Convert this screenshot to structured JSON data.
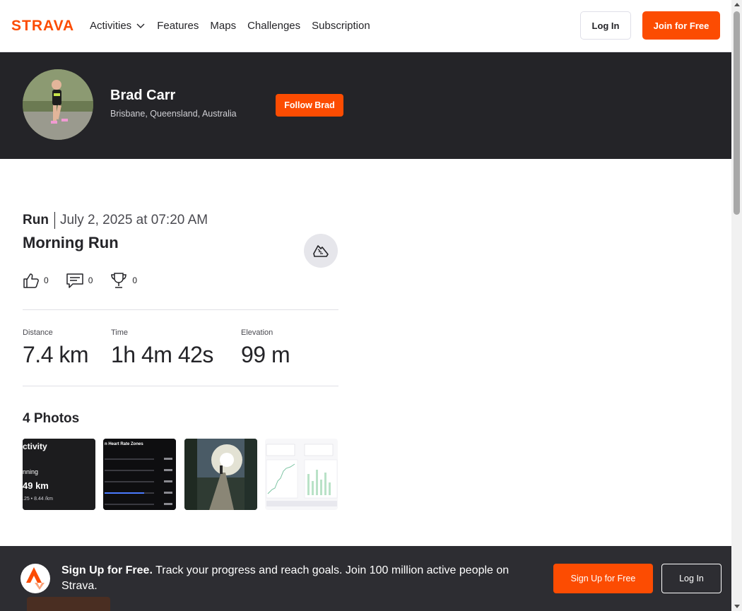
{
  "nav": {
    "brand": "STRAVA",
    "items": [
      {
        "label": "Activities",
        "has_dropdown": true
      },
      {
        "label": "Features"
      },
      {
        "label": "Maps"
      },
      {
        "label": "Challenges"
      },
      {
        "label": "Subscription"
      }
    ],
    "login_label": "Log In",
    "join_label": "Join for Free"
  },
  "athlete": {
    "name": "Brad Carr",
    "location": "Brisbane, Queensland, Australia",
    "follow_label": "Follow Brad"
  },
  "activity": {
    "type": "Run",
    "date": "July 2, 2025 at 07:20 AM",
    "title": "Morning Run",
    "kudos_count": "0",
    "comments_count": "0",
    "achievements_count": "0",
    "stats": [
      {
        "label": "Distance",
        "value": "7.4 km"
      },
      {
        "label": "Time",
        "value": "1h 4m 42s"
      },
      {
        "label": "Elevation",
        "value": "99 m"
      }
    ]
  },
  "photos": {
    "title": "4 Photos",
    "items": [
      {
        "caption_top": "ctivity",
        "caption_mid": "nning",
        "caption_value": "49 km",
        "caption_sub": ".25 • 8.44 /km"
      },
      {
        "caption_top": "n Heart Rate Zones"
      },
      {},
      {}
    ]
  },
  "signup_banner": {
    "headline": "Sign Up for Free.",
    "body": "Track your progress and reach goals. Join 100 million active people on Strava.",
    "signup_label": "Sign Up for Free",
    "login_label": "Log In"
  },
  "colors": {
    "brand": "#fc4c02",
    "header_dark": "#242428",
    "banner_dark": "#2d2d32"
  }
}
